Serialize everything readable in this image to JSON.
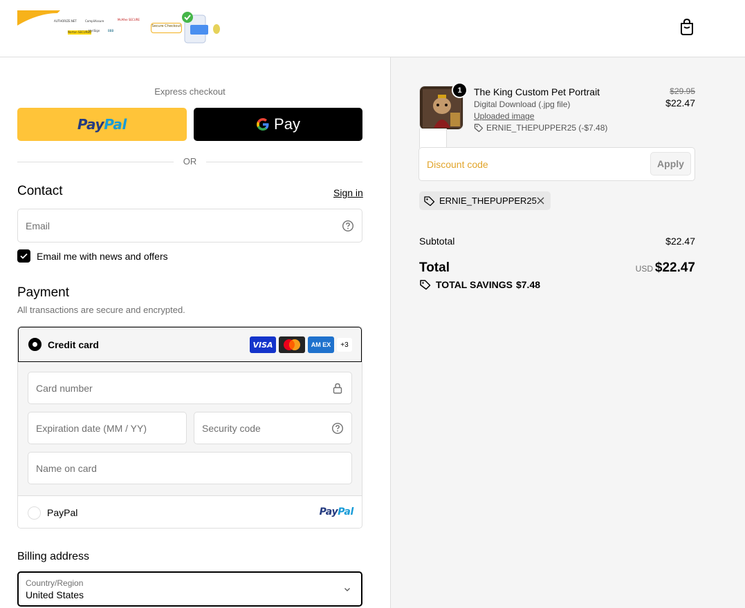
{
  "header": {
    "badges": [
      "AUTHORIZE.NET",
      "CompliAssure",
      "McAfee SECURE",
      "Norton SECURED",
      "VeriSign",
      "BBB"
    ],
    "secure_checkout_text": "Secure Checkout",
    "bag_icon": "shopping-bag-icon"
  },
  "express": {
    "title": "Express checkout",
    "paypal": {
      "part1": "Pay",
      "part2": "Pal"
    },
    "gpay": {
      "label": "Pay"
    },
    "divider": "OR"
  },
  "contact": {
    "heading": "Contact",
    "sign_in": "Sign in",
    "email_placeholder": "Email",
    "news_checkbox_label": "Email me with news and offers",
    "news_checked": true
  },
  "payment": {
    "heading": "Payment",
    "subtext": "All transactions are secure and encrypted.",
    "credit_card_label": "Credit card",
    "card_brands": {
      "visa": "VISA",
      "amex": "AM EX",
      "more": "+3"
    },
    "card_number_placeholder": "Card number",
    "expiration_placeholder": "Expiration date (MM / YY)",
    "security_placeholder": "Security code",
    "name_placeholder": "Name on card",
    "paypal_label": "PayPal",
    "paypal_logo": {
      "part1": "Pay",
      "part2": "Pal"
    }
  },
  "billing": {
    "heading": "Billing address",
    "country_caption": "Country/Region",
    "country_value": "United States"
  },
  "summary": {
    "product": {
      "title": "The King Custom Pet Portrait",
      "variant": "Digital Download (.jpg file)",
      "upload_link": "Uploaded image",
      "discount_line": "ERNIE_THEPUPPER25 (-$7.48)",
      "original_price": "$29.95",
      "price": "$22.47",
      "quantity": "1"
    },
    "discount_placeholder": "Discount code",
    "apply_label": "Apply",
    "applied_code": "ERNIE_THEPUPPER25",
    "subtotal_label": "Subtotal",
    "subtotal_value": "$22.47",
    "total_label": "Total",
    "currency": "USD",
    "total_value": "$22.47",
    "savings_label": "TOTAL SAVINGS",
    "savings_value": "$7.48"
  },
  "colors": {
    "paypal_yellow": "#ffc439",
    "discount_placeholder": "#e1a42a",
    "summary_bg": "#f5f5f5"
  }
}
